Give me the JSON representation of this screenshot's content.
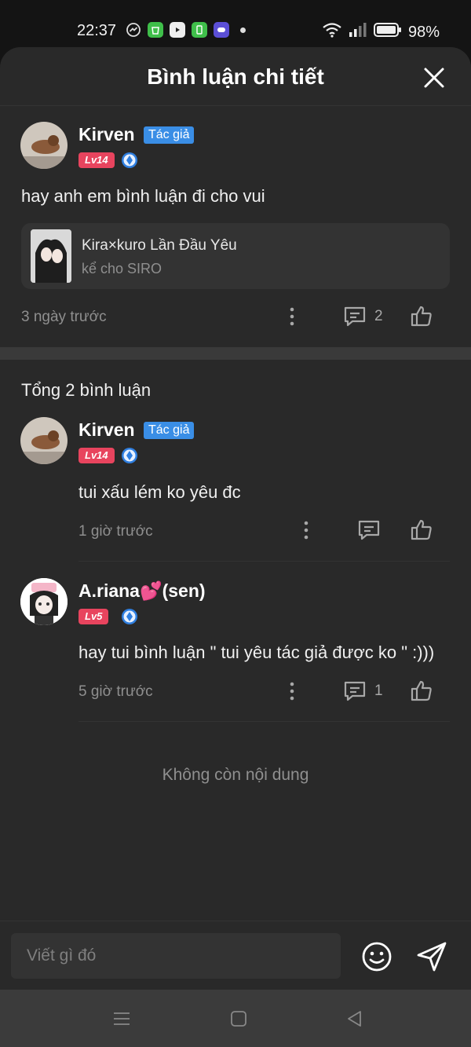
{
  "status_bar": {
    "time": "22:37",
    "battery": "98%"
  },
  "header": {
    "title": "Bình luận chi tiết"
  },
  "main_comment": {
    "username": "Kirven",
    "author_badge": "Tác giả",
    "level": "Lv14",
    "text": "hay anh em bình luận đi cho vui",
    "story": {
      "title": "Kira×kuro Lần Đầu Yêu",
      "subtitle": "kể cho SIRO"
    },
    "time": "3 ngày trước",
    "reply_count": "2"
  },
  "total_label": "Tổng 2 bình luận",
  "replies": [
    {
      "username": "Kirven",
      "author_badge": "Tác giả",
      "level": "Lv14",
      "text": "tui xấu lém ko yêu đc",
      "time": "1 giờ trước",
      "reply_count": ""
    },
    {
      "username": "A.riana💕(sen)",
      "level": "Lv5",
      "text": "hay tui bình luận \" tui yêu tác giả được ko \" :)))",
      "time": "5 giờ trước",
      "reply_count": "1"
    }
  ],
  "end_label": "Không còn nội dung",
  "composer": {
    "placeholder": "Viết gì đó"
  },
  "colors": {
    "sheet_bg": "#292929",
    "author_badge": "#3a8ee6",
    "level_badge": "#e8445e"
  }
}
